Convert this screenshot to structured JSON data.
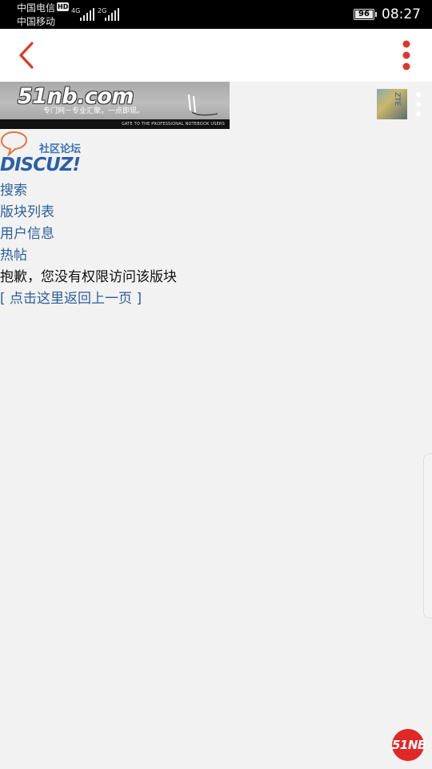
{
  "status_bar": {
    "carrier1": "中国电信",
    "carrier2": "中国移动",
    "hd_badge": "HD",
    "network1": "4G",
    "network2": "2G",
    "battery": "96",
    "time": "08:27"
  },
  "nav": {
    "back_icon": "chevron-left-icon",
    "more_icon": "more-vertical-icon",
    "accent": "#d93a2b"
  },
  "banner": {
    "logo": "51nb.com",
    "slogan": "专门网－专业汇聚，一点即现。",
    "tagline": "GATE TO THE PROFESSIONAL NOTEBOOK USERS"
  },
  "thumb": {
    "text": "ZTE"
  },
  "discuz": {
    "subtitle": "社区论坛",
    "logo": "DISCUZ!"
  },
  "menu": {
    "search": "搜索",
    "forum_list": "版块列表",
    "user_info": "用户信息",
    "hot_posts": "热帖",
    "error_message": "抱歉，您没有权限访问该版块",
    "back_link": "[ 点击这里返回上一页 ]"
  },
  "floating_badge": "51NB"
}
